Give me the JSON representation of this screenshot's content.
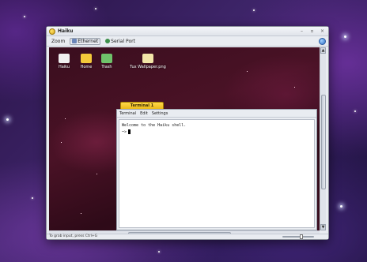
{
  "window": {
    "title": "Haiku",
    "controls": [
      "–",
      "▫",
      "×"
    ]
  },
  "toolbar": {
    "zoom_label": "Zoom",
    "ethernet_label": "Ethernet",
    "serial_label": "Serial Port"
  },
  "desktop_icons": [
    {
      "label": "Haiku",
      "icon": "computer-icon",
      "color": "#f0f0f0"
    },
    {
      "label": "Home",
      "icon": "home-folder-icon",
      "color": "#f3c93a"
    },
    {
      "label": "Trash",
      "icon": "trash-icon",
      "color": "#6fc36a"
    },
    {
      "label": "Tux Wallpaper.png",
      "icon": "image-file-icon",
      "color": "#f2e5a8"
    }
  ],
  "terminal": {
    "tab_title": "Terminal 1",
    "menu": [
      "Terminal",
      "Edit",
      "Settings"
    ],
    "welcome": "Welcome to the Haiku shell.",
    "prompt": "~>"
  },
  "status": {
    "text": "To grab input, press Ctrl+G"
  },
  "colors": {
    "tab_yellow": "#ffd84a",
    "desktop_bg": "#3a0e1e"
  }
}
